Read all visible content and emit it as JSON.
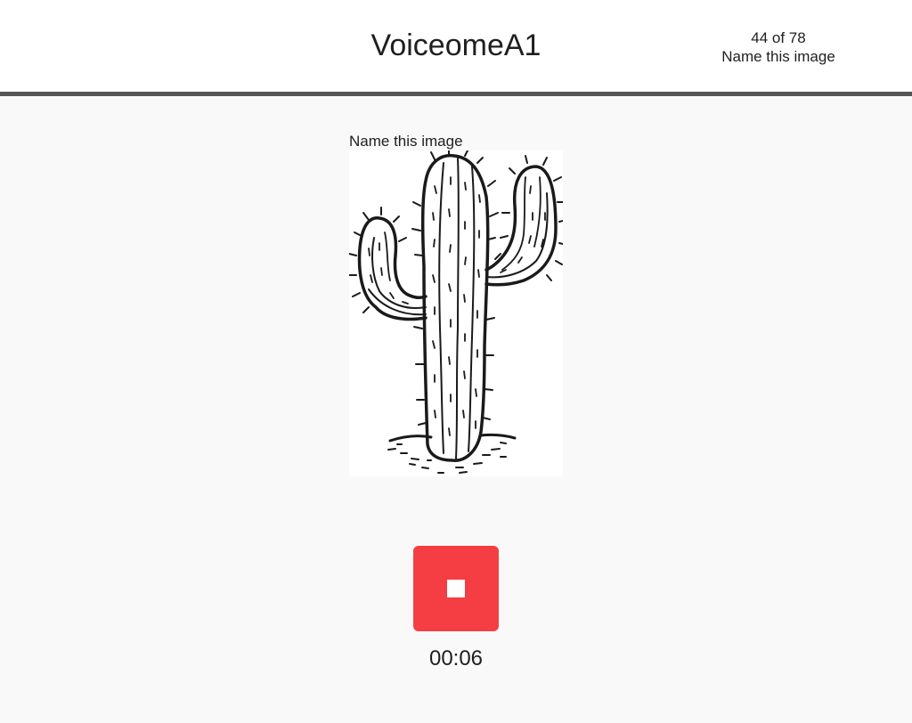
{
  "header": {
    "title": "VoiceomeA1",
    "progress_count": "44 of 78",
    "task_name": "Name this image"
  },
  "main": {
    "prompt_label": "Name this image",
    "image_subject": "cactus-illustration",
    "record_button": {
      "icon": "stop-icon",
      "color": "#f43e44",
      "state": "recording"
    },
    "timer": "00:06"
  }
}
